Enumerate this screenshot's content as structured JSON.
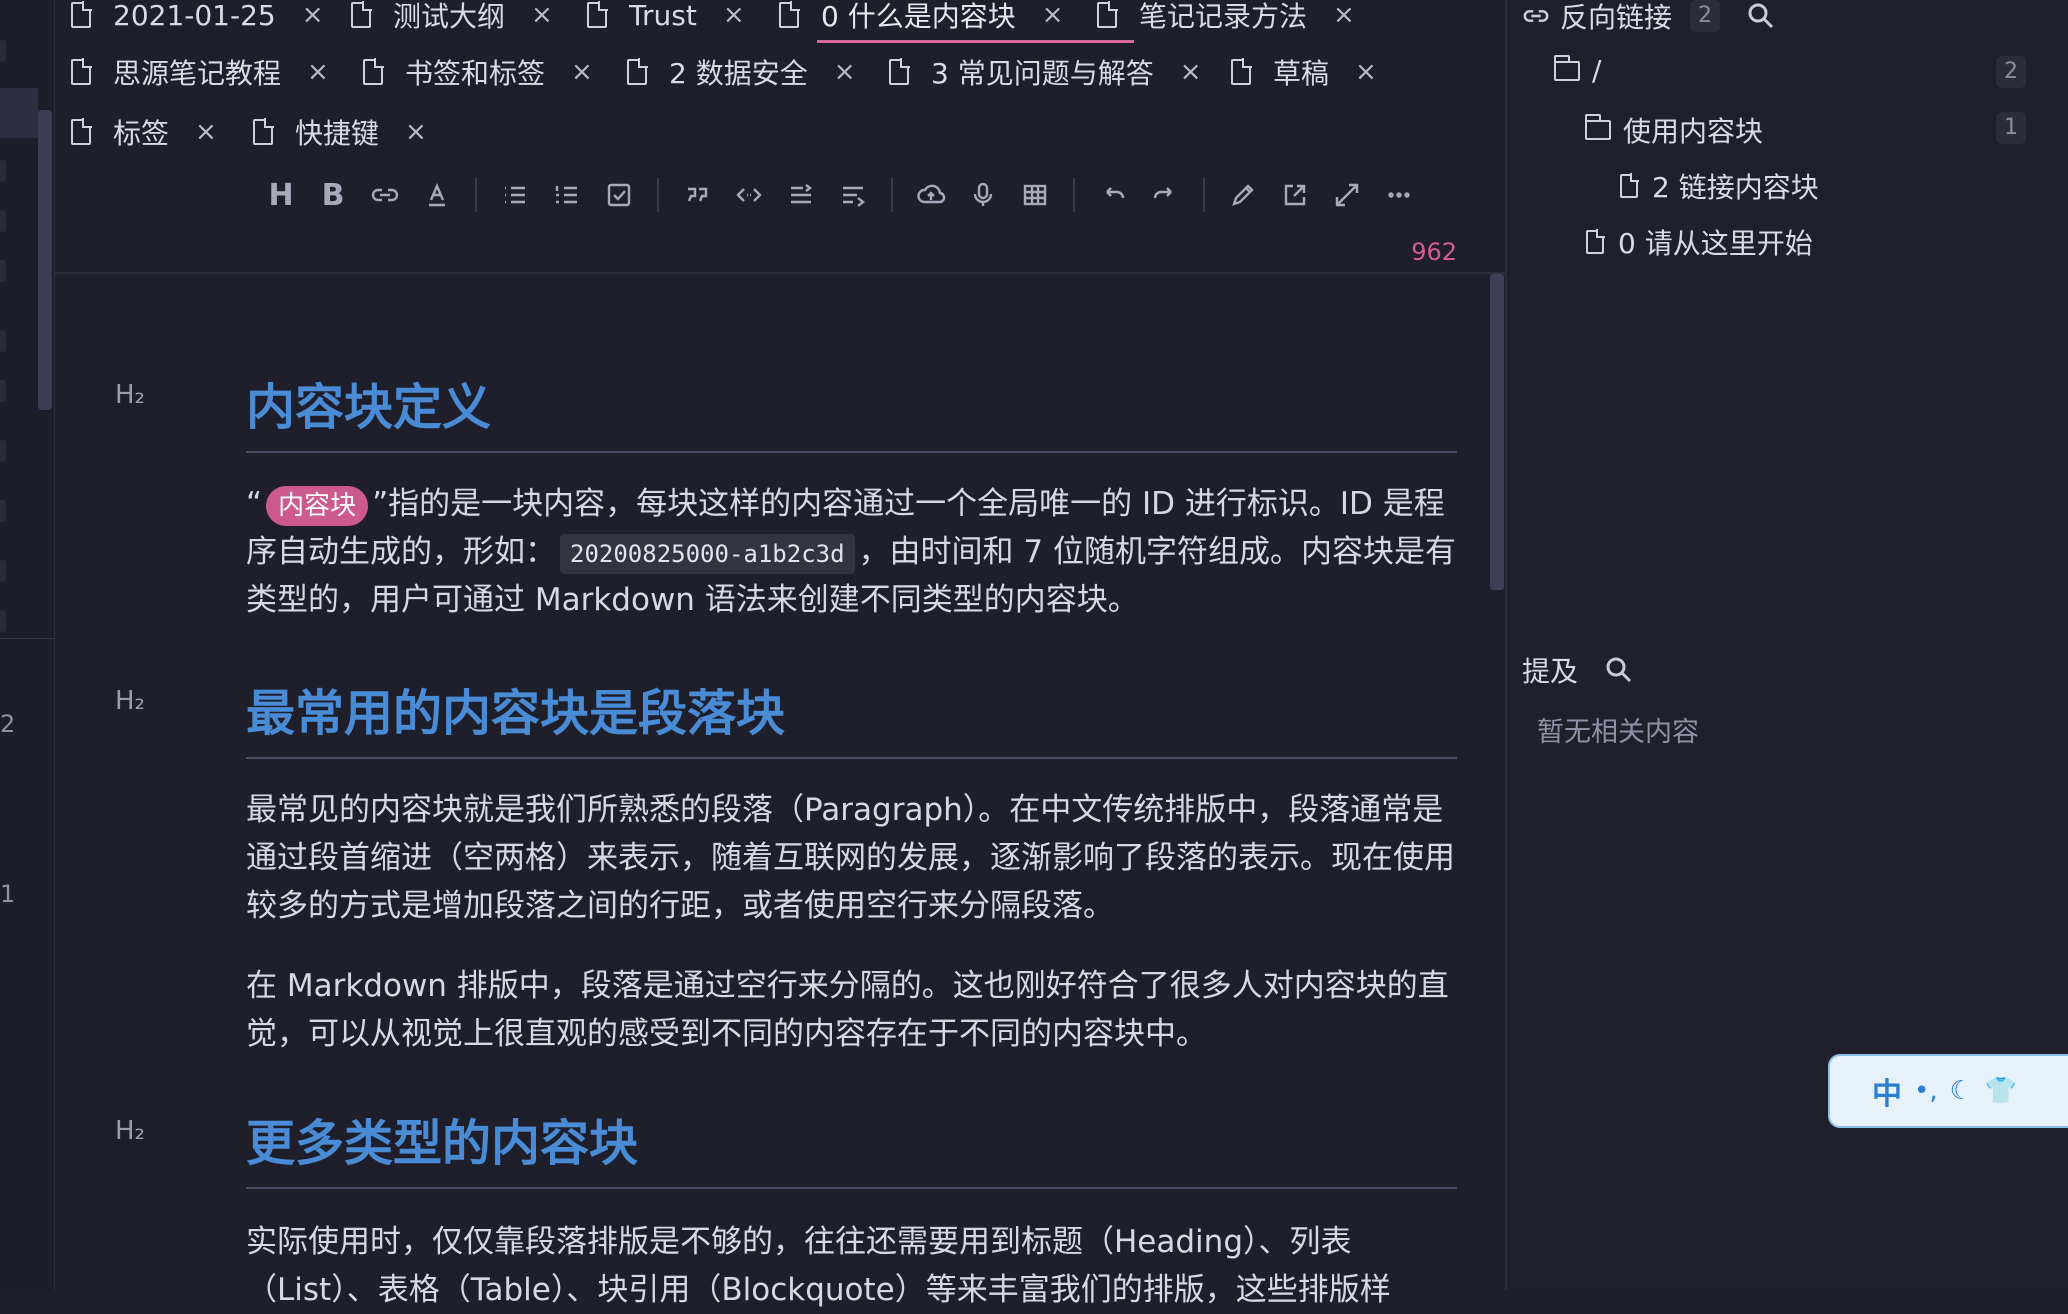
{
  "tabs": [
    {
      "label": "2021-01-25"
    },
    {
      "label": "测试大纲"
    },
    {
      "label": "Trust"
    },
    {
      "label": "0 什么是内容块"
    },
    {
      "label": "笔记记录方法"
    },
    {
      "label": "思源笔记教程"
    },
    {
      "label": "书签和标签"
    },
    {
      "label": "2 数据安全"
    },
    {
      "label": "3 常见问题与解答"
    },
    {
      "label": "草稿"
    },
    {
      "label": "标签"
    },
    {
      "label": "快捷键"
    }
  ],
  "active_tab": "0 什么是内容块",
  "close_glyph": "×",
  "toolbar_icons": [
    "heading-icon",
    "bold-icon",
    "link-icon",
    "font-color-icon",
    "bullet-list-icon",
    "ordered-list-icon",
    "task-list-icon",
    "quote-icon",
    "inline-code-icon",
    "indent-icon",
    "outdent-icon",
    "upload-icon",
    "record-icon",
    "table-icon",
    "undo-icon",
    "redo-icon",
    "edit-icon",
    "open-window-icon",
    "fullscreen-icon",
    "more-icon"
  ],
  "word_count": "962",
  "dock": {
    "counts": [
      "2",
      "1"
    ]
  },
  "content": {
    "h2_marker": "H₂",
    "sections": [
      {
        "heading": "内容块定义",
        "p1_open": "“",
        "p1_tag": "内容块",
        "p1_text_a": "”指的是一块内容，每块这样的内容通过一个全局唯一的 ID 进行标识。ID 是程序自动生成的，形如：",
        "p1_code": "20200825000-a1b2c3d",
        "p1_text_b": "，由时间和 7 位随机字符组成。内容块是有类型的，用户可通过 Markdown 语法来创建不同类型的内容块。"
      },
      {
        "heading": "最常用的内容块是段落块",
        "paragraphs": [
          "最常见的内容块就是我们所熟悉的段落（Paragraph）。在中文传统排版中，段落通常是通过段首缩进（空两格）来表示，随着互联网的发展，逐渐影响了段落的表示。现在使用较多的方式是增加段落之间的行距，或者使用空行来分隔段落。",
          "在 Markdown 排版中，段落是通过空行来分隔的。这也刚好符合了很多人对内容块的直觉，可以从视觉上很直观的感受到不同的内容存在于不同的内容块中。"
        ]
      },
      {
        "heading": "更多类型的内容块",
        "paragraphs": [
          "实际使用时，仅仅靠段落排版是不够的，往往还需要用到标题（Heading）、列表（List）、表格（Table）、块引用（Blockquote）等来丰富我们的排版，这些排版样"
        ]
      }
    ]
  },
  "backlinks": {
    "title": "反向链接",
    "count": "2",
    "root": {
      "label": "/",
      "count": "2"
    },
    "folder": {
      "label": "使用内容块",
      "count": "1"
    },
    "doc_child": {
      "label": "2 链接内容块"
    },
    "doc_root": {
      "label": "0 请从这里开始"
    }
  },
  "mentions": {
    "title": "提及",
    "empty": "暂无相关内容"
  },
  "ime": {
    "lang": "中"
  },
  "colors": {
    "accent": "#d96aa0",
    "heading": "#4a8bd6",
    "tag": "#cd5a8d",
    "bg": "#1e1f2b"
  }
}
